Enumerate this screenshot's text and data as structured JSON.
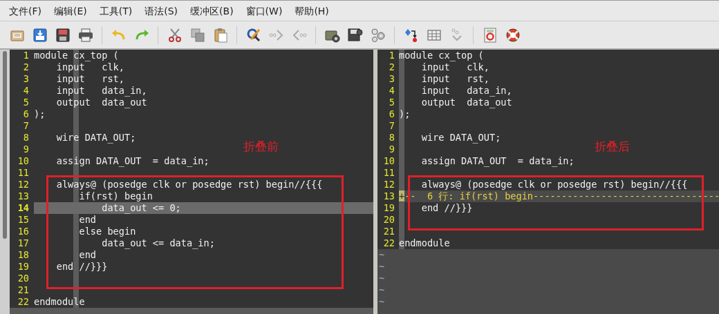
{
  "menu": [
    {
      "label": "文件(F)"
    },
    {
      "label": "编辑(E)"
    },
    {
      "label": "工具(T)"
    },
    {
      "label": "语法(S)"
    },
    {
      "label": "缓冲区(B)"
    },
    {
      "label": "窗口(W)"
    },
    {
      "label": "帮助(H)"
    }
  ],
  "panes": [
    {
      "annotation": "折叠前",
      "sections": [
        {
          "boxed": false,
          "lines": [
            {
              "number": "1",
              "text": "module cx_top (",
              "kind": "code",
              "cursor": false
            },
            {
              "number": "2",
              "text": "    input   clk,",
              "kind": "code",
              "cursor": false
            },
            {
              "number": "3",
              "text": "    input   rst,",
              "kind": "code",
              "cursor": false
            },
            {
              "number": "4",
              "text": "    input   data_in,",
              "kind": "code",
              "cursor": false
            },
            {
              "number": "5",
              "text": "    output  data_out",
              "kind": "code",
              "cursor": false
            },
            {
              "number": "6",
              "text": ");",
              "kind": "code",
              "cursor": false
            },
            {
              "number": "7",
              "kind": "code",
              "cursor": false
            },
            {
              "number": "8",
              "text": "    wire DATA_OUT;",
              "kind": "code",
              "cursor": false
            },
            {
              "number": "9",
              "kind": "code",
              "cursor": false
            },
            {
              "number": "10",
              "text": "    assign DATA_OUT  = data_in;",
              "kind": "code",
              "cursor": false
            },
            {
              "number": "11",
              "kind": "code",
              "cursor": false
            }
          ]
        },
        {
          "boxed": true,
          "lines": [
            {
              "number": "12",
              "text": "    always@ (posedge clk or posedge rst) begin//{{{",
              "kind": "code",
              "cursor": false
            },
            {
              "number": "13",
              "text": "        if(rst) begin",
              "kind": "code",
              "cursor": false
            },
            {
              "number": "14",
              "text": "            data_out <= 0;",
              "kind": "code",
              "cursor": true
            },
            {
              "number": "15",
              "text": "        end",
              "kind": "code",
              "cursor": false
            },
            {
              "number": "16",
              "text": "        else begin",
              "kind": "code",
              "cursor": false
            },
            {
              "number": "17",
              "text": "            data_out <= data_in;",
              "kind": "code",
              "cursor": false
            },
            {
              "number": "18",
              "text": "        end",
              "kind": "code",
              "cursor": false
            },
            {
              "number": "19",
              "text": "    end //}}}",
              "kind": "code",
              "cursor": false
            },
            {
              "number": "20",
              "kind": "code",
              "cursor": false
            }
          ]
        },
        {
          "boxed": false,
          "lines": [
            {
              "number": "21",
              "kind": "code",
              "cursor": false
            },
            {
              "number": "22",
              "text": "endmodule",
              "kind": "code",
              "cursor": false
            }
          ]
        }
      ]
    },
    {
      "annotation": "折叠后",
      "sections": [
        {
          "boxed": false,
          "lines": [
            {
              "number": "1",
              "text": "module cx_top (",
              "kind": "code",
              "cursor": false
            },
            {
              "number": "2",
              "text": "    input   clk,",
              "kind": "code",
              "cursor": false
            },
            {
              "number": "3",
              "text": "    input   rst,",
              "kind": "code",
              "cursor": false
            },
            {
              "number": "4",
              "text": "    input   data_in,",
              "kind": "code",
              "cursor": false
            },
            {
              "number": "5",
              "text": "    output  data_out",
              "kind": "code",
              "cursor": false
            },
            {
              "number": "6",
              "text": ");",
              "kind": "code",
              "cursor": false
            },
            {
              "number": "7",
              "kind": "code",
              "cursor": false
            },
            {
              "number": "8",
              "text": "    wire DATA_OUT;",
              "kind": "code",
              "cursor": false
            },
            {
              "number": "9",
              "kind": "code",
              "cursor": false
            },
            {
              "number": "10",
              "text": "    assign DATA_OUT  = data_in;",
              "kind": "code",
              "cursor": false
            },
            {
              "number": "11",
              "kind": "code",
              "cursor": false
            }
          ]
        },
        {
          "boxed": true,
          "lines": [
            {
              "number": "12",
              "text": "    always@ (posedge clk or posedge rst) begin//{{{",
              "kind": "code",
              "cursor": false
            },
            {
              "number": "13",
              "text": "+--  6 行: if(rst) begin---------------------------------",
              "kind": "fold",
              "cursor": false
            },
            {
              "number": "19",
              "text": "    end //}}}",
              "kind": "code",
              "cursor": false
            },
            {
              "number": "20",
              "kind": "code",
              "cursor": false
            }
          ]
        },
        {
          "boxed": false,
          "lines": [
            {
              "number": "21",
              "kind": "code",
              "cursor": false
            },
            {
              "number": "22",
              "text": "endmodule",
              "kind": "code",
              "cursor": false
            }
          ]
        }
      ],
      "filler": [
        "~",
        "~",
        "~",
        "~",
        "~"
      ]
    }
  ]
}
